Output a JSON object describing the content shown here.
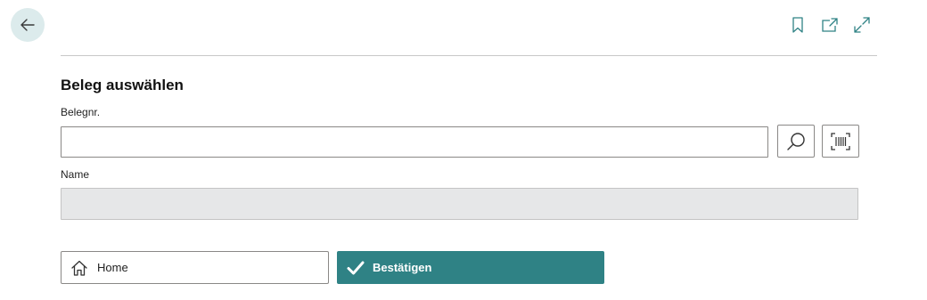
{
  "header": {
    "back_icon": "arrow-left-icon",
    "actions": [
      {
        "icon": "bookmark-icon"
      },
      {
        "icon": "open-in-new-window-icon"
      },
      {
        "icon": "expand-icon"
      }
    ]
  },
  "form": {
    "title": "Beleg auswählen",
    "document_no_label": "Belegnr.",
    "document_no_value": "",
    "search_icon": "search-icon",
    "scan_icon": "barcode-scan-icon",
    "name_label": "Name",
    "name_value": ""
  },
  "actions": {
    "home_label": "Home",
    "home_icon": "home-icon",
    "confirm_label": "Bestätigen",
    "confirm_icon": "checkmark-icon"
  },
  "colors": {
    "accent": "#2f8285",
    "back_button_bg": "#dcebec",
    "readonly_field_bg": "#e6e7e8"
  }
}
